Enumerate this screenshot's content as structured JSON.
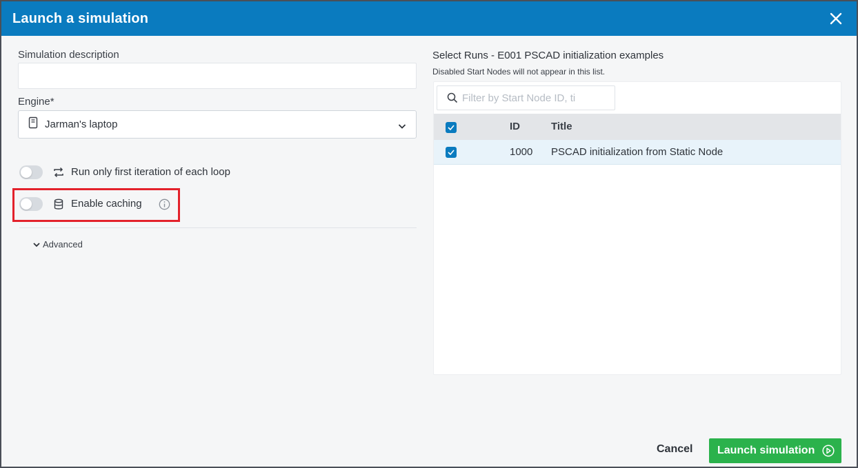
{
  "dialog": {
    "title": "Launch a simulation"
  },
  "left": {
    "description_label": "Simulation description",
    "description_value": "",
    "engine_label": "Engine*",
    "engine_value": "Jarman's laptop",
    "options": [
      {
        "label": "Run only first iteration of each loop",
        "enabled": false,
        "icon": "loop-icon"
      },
      {
        "label": "Enable caching",
        "enabled": false,
        "icon": "database-icon"
      }
    ],
    "advanced_label": "Advanced"
  },
  "runs": {
    "title": "Select Runs - E001 PSCAD initialization examples",
    "subtitle": "Disabled Start Nodes will not appear in this list.",
    "filter_placeholder": "Filter by Start Node ID, ti",
    "columns": [
      "ID",
      "Title"
    ],
    "rows": [
      {
        "checked": true,
        "id": "1000",
        "title": "PSCAD initialization from Static Node"
      }
    ],
    "all_checked": true
  },
  "footer": {
    "cancel_label": "Cancel",
    "launch_label": "Launch simulation"
  },
  "colors": {
    "header": "#0a7bbf",
    "launch": "#2bb24c",
    "highlight": "#e3212b"
  }
}
